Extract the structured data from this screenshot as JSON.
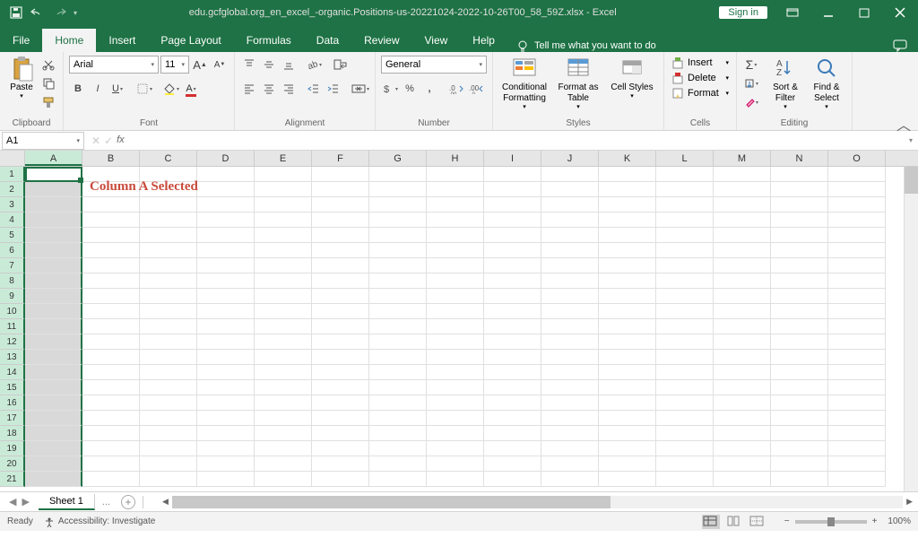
{
  "title": "edu.gcfglobal.org_en_excel_-organic.Positions-us-20221024-2022-10-26T00_58_59Z.xlsx - Excel",
  "signin": "Sign in",
  "tabs": {
    "file": "File",
    "home": "Home",
    "insert": "Insert",
    "page_layout": "Page Layout",
    "formulas": "Formulas",
    "data": "Data",
    "review": "Review",
    "view": "View",
    "help": "Help",
    "tellme": "Tell me what you want to do"
  },
  "ribbon": {
    "clipboard": {
      "label": "Clipboard",
      "paste": "Paste"
    },
    "font": {
      "label": "Font",
      "name": "Arial",
      "size": "11"
    },
    "alignment": {
      "label": "Alignment"
    },
    "number": {
      "label": "Number",
      "format": "General"
    },
    "styles": {
      "label": "Styles",
      "cond": "Conditional Formatting",
      "table": "Format as Table",
      "cell": "Cell Styles"
    },
    "cells": {
      "label": "Cells",
      "insert": "Insert",
      "delete": "Delete",
      "format": "Format"
    },
    "editing": {
      "label": "Editing",
      "sort": "Sort & Filter",
      "find": "Find & Select"
    }
  },
  "namebox": "A1",
  "columns": [
    "A",
    "B",
    "C",
    "D",
    "E",
    "F",
    "G",
    "H",
    "I",
    "J",
    "K",
    "L",
    "M",
    "N",
    "O"
  ],
  "rows": [
    "1",
    "2",
    "3",
    "4",
    "5",
    "6",
    "7",
    "8",
    "9",
    "10",
    "11",
    "12",
    "13",
    "14",
    "15",
    "16",
    "17",
    "18",
    "19",
    "20",
    "21"
  ],
  "annotation": "Column A Selected",
  "sheet": {
    "name": "Sheet 1",
    "dots": "..."
  },
  "status": {
    "ready": "Ready",
    "accessibility": "Accessibility: Investigate",
    "zoom": "100%"
  }
}
